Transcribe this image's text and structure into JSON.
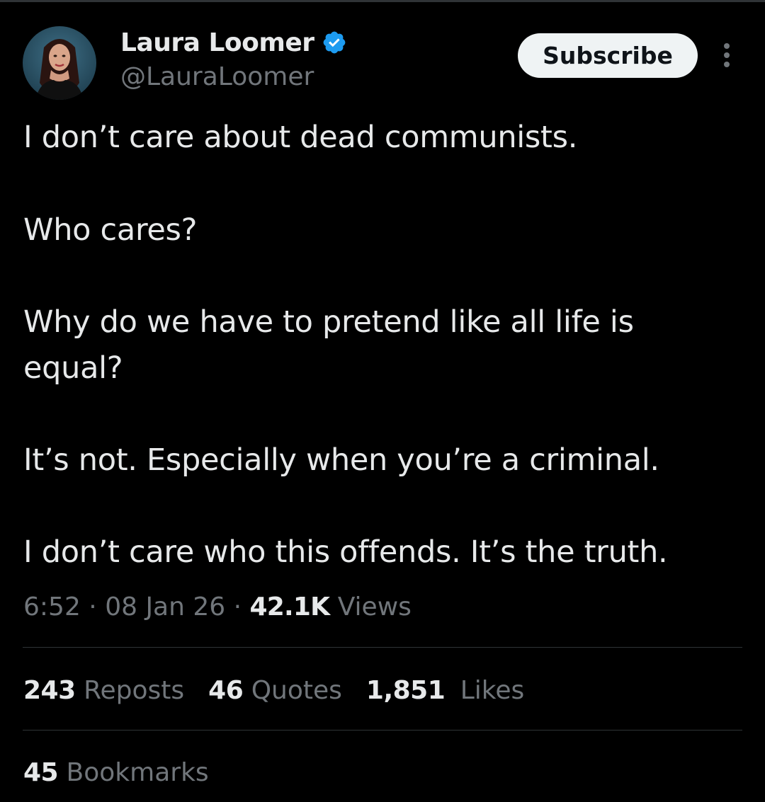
{
  "tweet": {
    "author": {
      "display_name": "Laura Loomer",
      "handle": "@LauraLoomer",
      "verified": true,
      "verified_color": "#1d9bf0",
      "avatar_icon": "profile-photo"
    },
    "subscribe_label": "Subscribe",
    "more_icon": "more-vertical-icon",
    "lines": [
      "I don’t care about dead communists.",
      "Who cares?",
      "Why do we have to pretend like all life is",
      "equal?",
      "It’s not. Especially when you’re a criminal.",
      "I don’t care who this offends. It’s the truth."
    ],
    "meta": {
      "time": "6:52",
      "sep1": " · ",
      "date": "08 Jan 26",
      "sep2": " · ",
      "views_count": "42.1K",
      "views_label": " Views"
    },
    "stats": {
      "reposts_count": "243",
      "reposts_label": " Reposts",
      "quotes_count": "46",
      "quotes_label": " Quotes",
      "likes_count": "1,851",
      "likes_label": " Likes",
      "bookmarks_count": "45",
      "bookmarks_label": " Bookmarks"
    }
  },
  "colors": {
    "background": "#000000",
    "primary_text": "#e7e9ea",
    "secondary_text": "#71767b",
    "divider": "#2f3336",
    "button_bg": "#eff3f4",
    "button_text": "#0f1419",
    "verified": "#1d9bf0"
  }
}
